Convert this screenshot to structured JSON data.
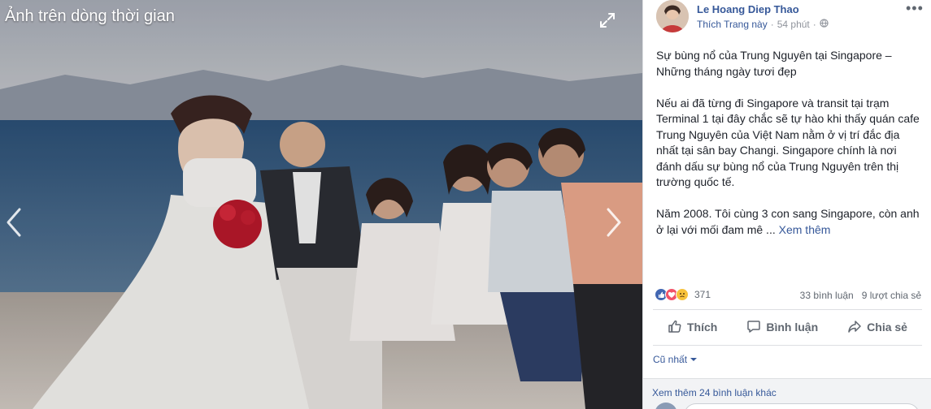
{
  "viewer": {
    "title": "Ảnh trên dòng thời gian",
    "icons": {
      "expand": "expand-icon",
      "prev": "chevron-left-icon",
      "next": "chevron-right-icon"
    }
  },
  "post": {
    "author": "Le Hoang Diep Thao",
    "like_page": "Thích Trang này",
    "separator": "·",
    "time": "54 phút",
    "privacy_icon": "globe-icon",
    "more": "•••",
    "paragraphs": [
      "Sự bùng nổ của Trung Nguyên tại Singapore – Những tháng ngày tươi đẹp",
      "Nếu ai đã từng đi Singapore và transit tại trạm Terminal 1 tại đây chắc sẽ tự hào khi thấy quán cafe Trung Nguyên của Việt Nam nằm ở vị trí đắc địa nhất tại sân bay Changi. Singapore chính là nơi đánh dấu sự bùng nổ của Trung Nguyên trên thị trường quốc tế.",
      "Năm 2008. Tôi cùng 3 con sang Singapore, còn anh ở lại với mối đam mê ..."
    ],
    "see_more": "Xem thêm"
  },
  "engagement": {
    "reaction_count": "371",
    "reaction_icons": [
      "like-reaction-icon",
      "love-reaction-icon",
      "sad-reaction-icon"
    ],
    "comments": "33 bình luận",
    "shares": "9 lượt chia sẻ"
  },
  "actions": {
    "like": "Thích",
    "comment": "Bình luận",
    "share": "Chia sẻ"
  },
  "comments": {
    "sort_label": "Cũ nhất",
    "view_more": "Xem thêm 24 bình luận khác"
  },
  "colors": {
    "link": "#365899",
    "text": "#1d2129",
    "muted": "#90949c",
    "like_blue": "#4267b2",
    "love_red": "#f25268",
    "sad_yellow": "#f7c23c"
  }
}
